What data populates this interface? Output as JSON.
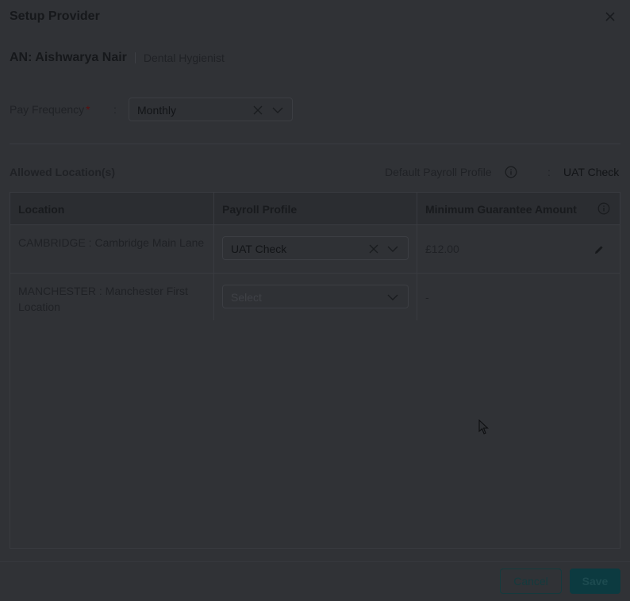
{
  "dialog": {
    "title": "Setup Provider",
    "close_icon": "close-icon"
  },
  "provider": {
    "name": "AN: Aishwarya Nair",
    "role": "Dental Hygienist"
  },
  "pay_frequency": {
    "label": "Pay Frequency",
    "required_mark": "*",
    "colon": ":",
    "value": "Monthly"
  },
  "allowed_locations": {
    "title": "Allowed Location(s)",
    "default_payroll_label": "Default Payroll Profile",
    "colon": ":",
    "default_payroll_value": "UAT Check"
  },
  "table": {
    "headers": {
      "location": "Location",
      "payroll_profile": "Payroll Profile",
      "min_guarantee": "Minimum Guarantee Amount"
    },
    "rows": [
      {
        "location": "CAMBRIDGE : Cambridge Main Lane",
        "payroll_profile": "UAT Check",
        "amount": "£12.00"
      },
      {
        "location": "MANCHESTER : Manchester First Location",
        "payroll_profile_placeholder": "Select",
        "amount": "-"
      }
    ]
  },
  "footer": {
    "cancel": "Cancel",
    "save": "Save"
  }
}
